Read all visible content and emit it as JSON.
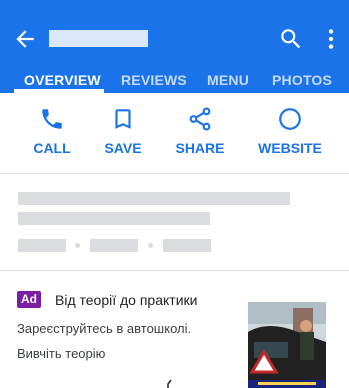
{
  "colors": {
    "primary": "#1a73e8",
    "ad_badge": "#7b1fa2",
    "placeholder": "#dadce0"
  },
  "appbar": {
    "back_icon": "arrow-left",
    "search_icon": "search",
    "more_icon": "more-vertical"
  },
  "tabs": [
    {
      "label": "OVERVIEW",
      "active": true
    },
    {
      "label": "REVIEWS",
      "active": false
    },
    {
      "label": "MENU",
      "active": false
    },
    {
      "label": "PHOTOS",
      "active": false
    }
  ],
  "actions": [
    {
      "label": "CALL",
      "icon": "phone"
    },
    {
      "label": "SAVE",
      "icon": "bookmark"
    },
    {
      "label": "SHARE",
      "icon": "share"
    },
    {
      "label": "WEBSITE",
      "icon": "globe-circle"
    }
  ],
  "ad": {
    "badge": "Ad",
    "title": "Від теорії до практики",
    "line1": "Зареєструйтесь в автошколі.",
    "line2": "Вивчіть теорію"
  }
}
